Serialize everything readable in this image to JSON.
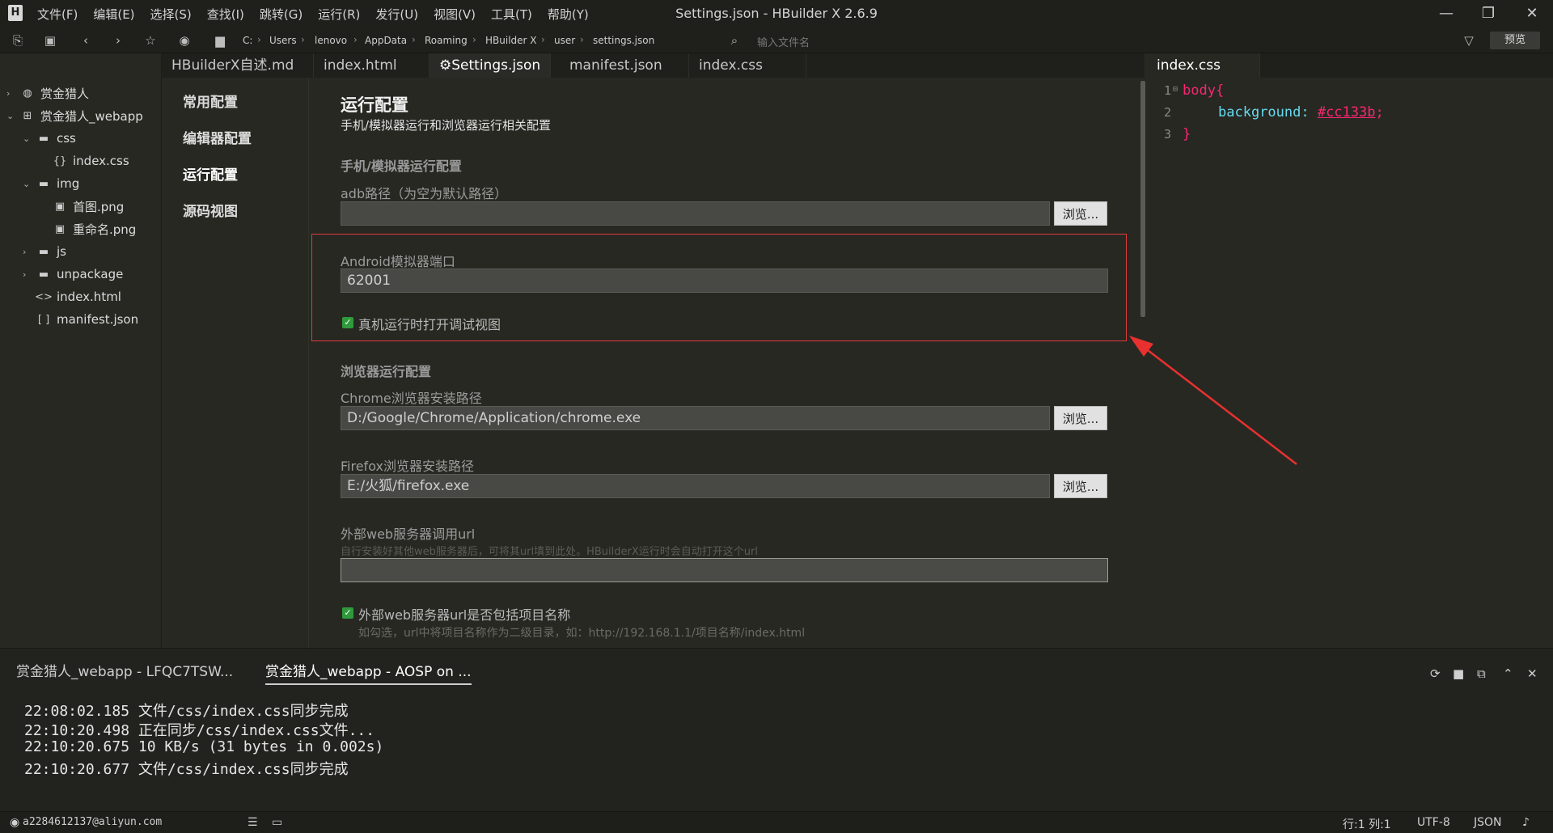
{
  "titlebar": {
    "menus": [
      "文件(F)",
      "编辑(E)",
      "选择(S)",
      "查找(I)",
      "跳转(G)",
      "运行(R)",
      "发行(U)",
      "视图(V)",
      "工具(T)",
      "帮助(Y)"
    ],
    "title": "Settings.json - HBuilder X 2.6.9",
    "minimize": "—",
    "maximize": "❐",
    "close": "✕"
  },
  "toolbar": {
    "breadcrumb": [
      "C:",
      "Users",
      "lenovo",
      "AppData",
      "Roaming",
      "HBuilder X",
      "user",
      "settings.json"
    ],
    "search_placeholder": "输入文件名",
    "preview": "预览"
  },
  "sidebar": {
    "items": [
      {
        "label": "赏金猎人",
        "icon": "project-icon"
      },
      {
        "label": "赏金猎人_webapp",
        "icon": "webapp-icon"
      },
      {
        "label": "css",
        "icon": "folder-icon"
      },
      {
        "label": "index.css",
        "icon": "css-file-icon"
      },
      {
        "label": "img",
        "icon": "folder-icon"
      },
      {
        "label": "首图.png",
        "icon": "image-file-icon"
      },
      {
        "label": "重命名.png",
        "icon": "image-file-icon"
      },
      {
        "label": "js",
        "icon": "folder-icon"
      },
      {
        "label": "unpackage",
        "icon": "folder-icon"
      },
      {
        "label": "index.html",
        "icon": "html-file-icon"
      },
      {
        "label": "manifest.json",
        "icon": "json-file-icon"
      }
    ]
  },
  "tabs": {
    "left": [
      "HBuilderX自述.md",
      "index.html",
      "Settings.json",
      "manifest.json",
      "index.css"
    ],
    "right": [
      "index.css"
    ]
  },
  "settings_nav": [
    "常用配置",
    "编辑器配置",
    "运行配置",
    "源码视图"
  ],
  "settings": {
    "title": "运行配置",
    "subtitle": "手机/模拟器运行和浏览器运行相关配置",
    "phone_section": "手机/模拟器运行配置",
    "adb_label": "adb路径（为空为默认路径）",
    "adb_value": "",
    "browse": "浏览...",
    "android_port_label": "Android模拟器端口",
    "android_port_value": "62001",
    "debug_view_label": "真机运行时打开调试视图",
    "browser_section": "浏览器运行配置",
    "chrome_label": "Chrome浏览器安装路径",
    "chrome_value": "D:/Google/Chrome/Application/chrome.exe",
    "firefox_label": "Firefox浏览器安装路径",
    "firefox_value": "E:/火狐/firefox.exe",
    "web_server_label": "外部web服务器调用url",
    "web_server_hint": "自行安装好其他web服务器后，可将其url填到此处。HBuilderX运行时会自动打开这个url",
    "web_server_value": "",
    "include_project_label": "外部web服务器url是否包括项目名称",
    "include_project_hint": "如勾选，url中将项目名称作为二级目录，如：http://192.168.1.1/项目名称/index.html"
  },
  "code": {
    "line_numbers": [
      "1",
      "2",
      "3"
    ],
    "line1_selector": "body{",
    "line2_property": "background: ",
    "line2_value": "#cc133b",
    "line2_end": ";",
    "line3": "}"
  },
  "console": {
    "tabs": [
      "赏金猎人_webapp - LFQC7TSW...",
      "赏金猎人_webapp - AOSP on ..."
    ],
    "lines": [
      "22:08:02.185 文件/css/index.css同步完成",
      "22:10:20.498 正在同步/css/index.css文件...",
      "22:10:20.675 10 KB/s (31 bytes in 0.002s)",
      "22:10:20.677 文件/css/index.css同步完成"
    ]
  },
  "statusbar": {
    "account": "a2284612137@aliyun.com",
    "position": "行:1  列:1",
    "encoding": "UTF-8",
    "language": "JSON"
  },
  "colors": {
    "accent_highlight": "#e03c3c",
    "checkbox": "#2f9a3b",
    "code_keyword": "#f92672",
    "code_property": "#66d9ef"
  }
}
